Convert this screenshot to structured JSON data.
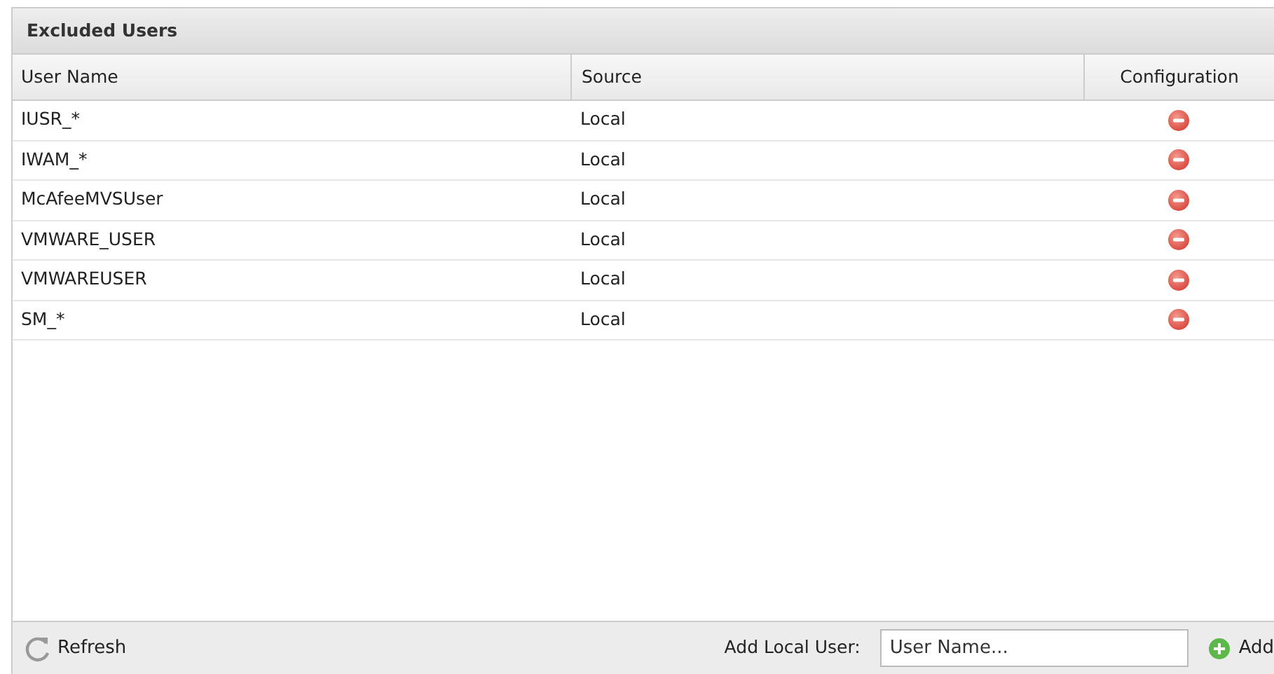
{
  "panel": {
    "title": "Excluded Users"
  },
  "table": {
    "columns": [
      "User Name",
      "Source",
      "Configuration"
    ],
    "rows": [
      {
        "user_name": "IUSR_*",
        "source": "Local"
      },
      {
        "user_name": "IWAM_*",
        "source": "Local"
      },
      {
        "user_name": "McAfeeMVSUser",
        "source": "Local"
      },
      {
        "user_name": "VMWARE_USER",
        "source": "Local"
      },
      {
        "user_name": "VMWAREUSER",
        "source": "Local"
      },
      {
        "user_name": "SM_*",
        "source": "Local"
      }
    ]
  },
  "footer": {
    "refresh": "Refresh",
    "add_label": "Add Local User:",
    "placeholder": "User Name...",
    "add": "Add"
  }
}
